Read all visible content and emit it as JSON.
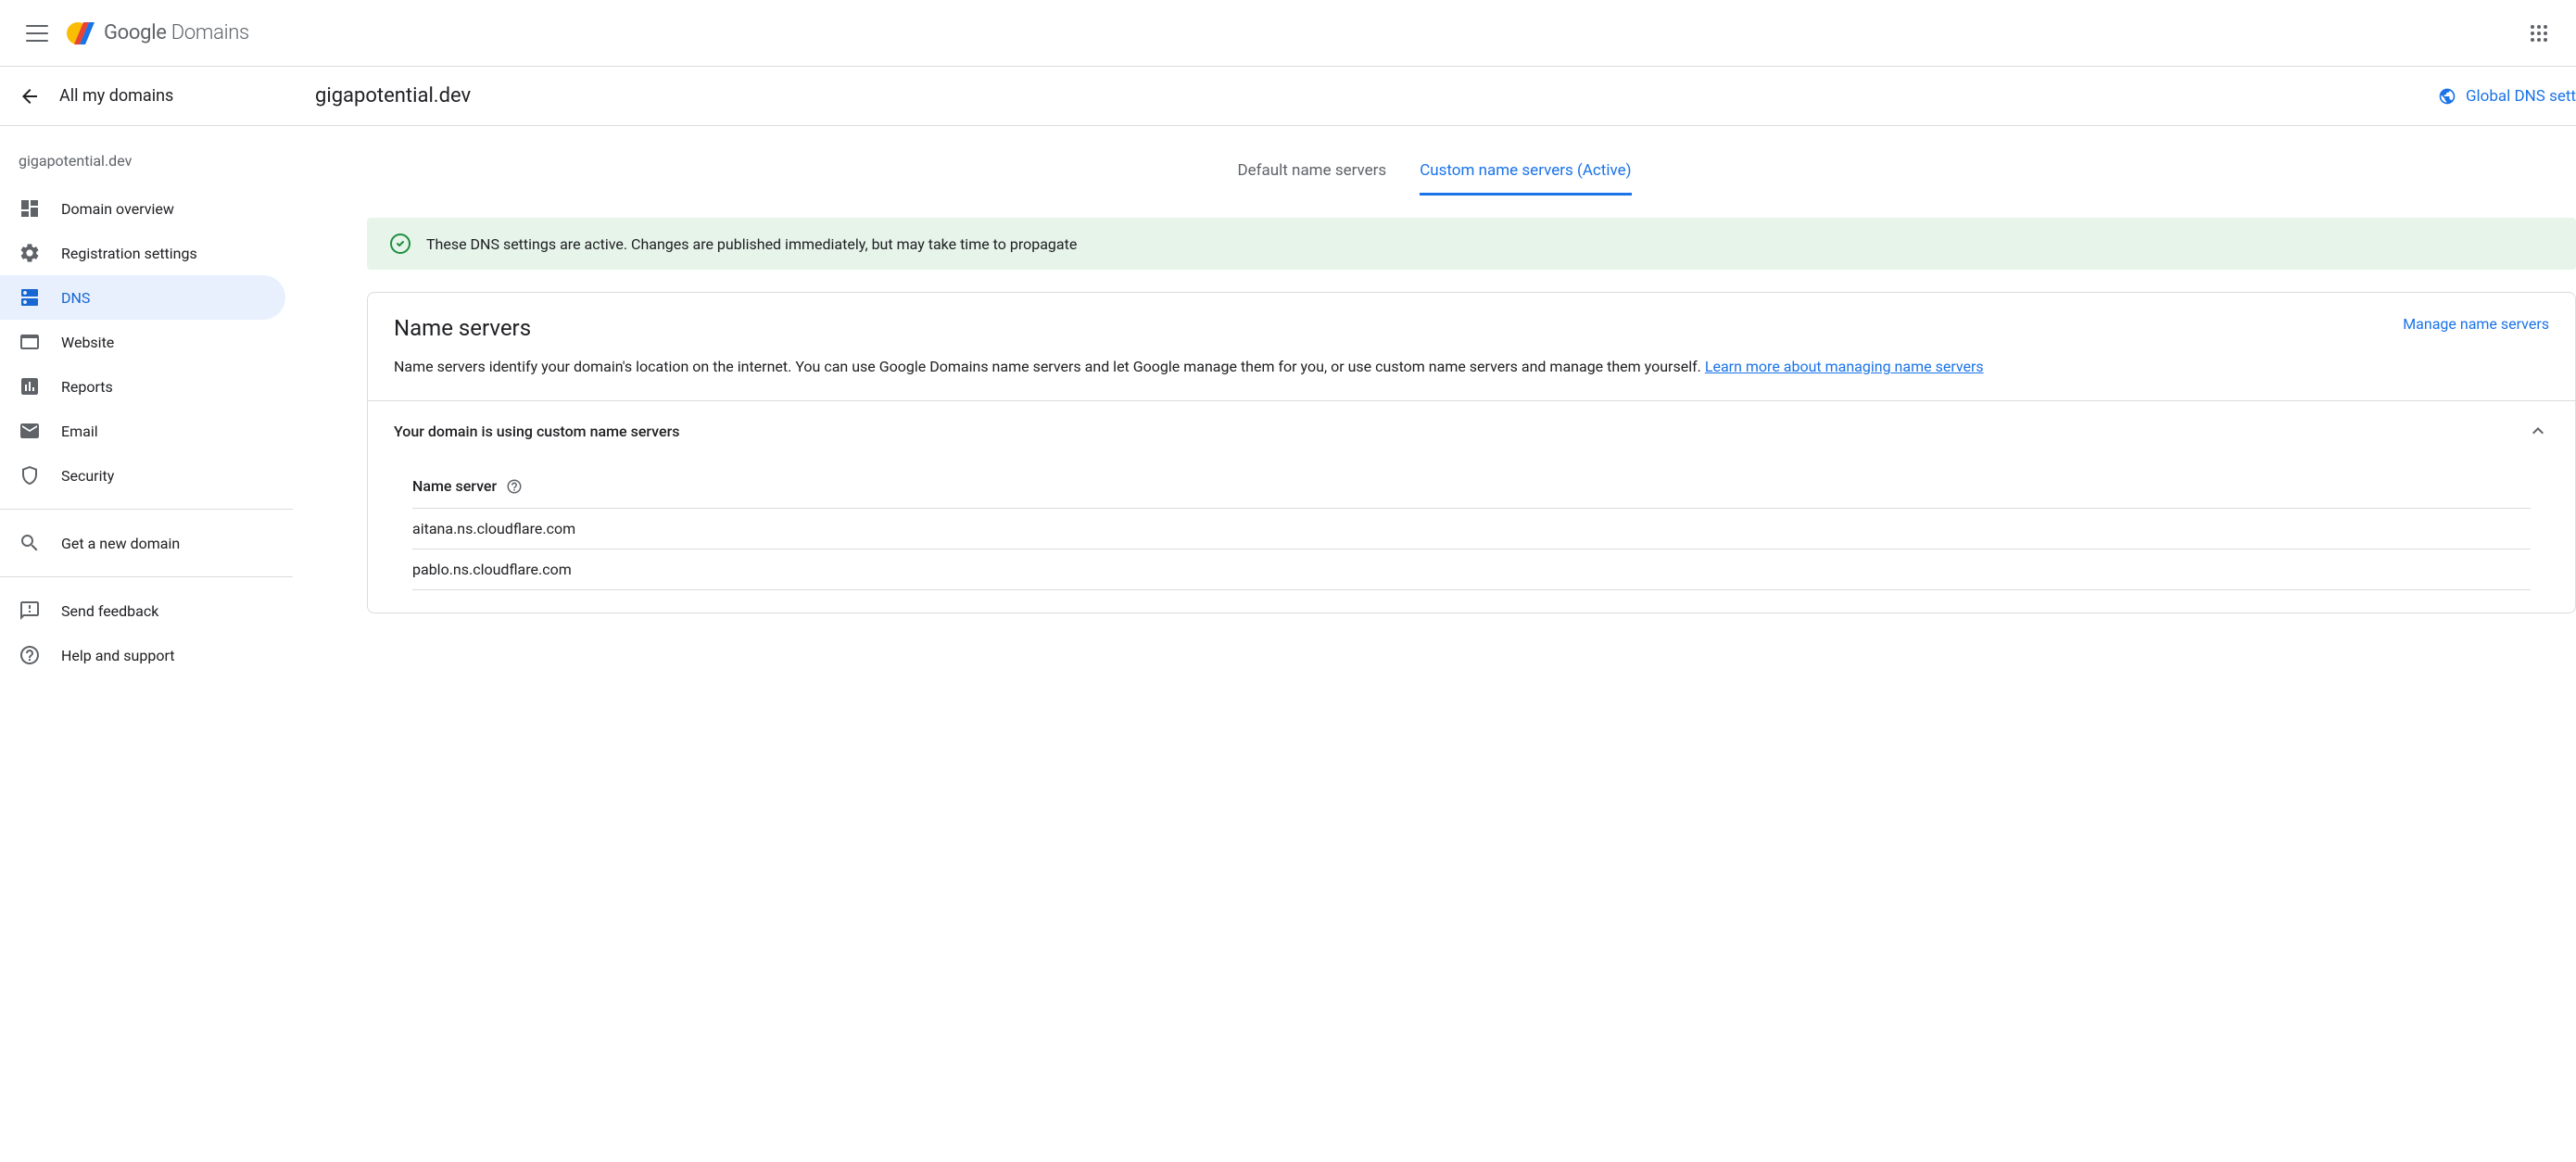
{
  "header": {
    "logo_google": "Google",
    "logo_domains": " Domains"
  },
  "subheader": {
    "back_label": "All my domains",
    "domain_name": "gigapotential.dev",
    "global_dns": "Global DNS sett"
  },
  "sidebar": {
    "domain": "gigapotential.dev",
    "items": [
      {
        "label": "Domain overview"
      },
      {
        "label": "Registration settings"
      },
      {
        "label": "DNS"
      },
      {
        "label": "Website"
      },
      {
        "label": "Reports"
      },
      {
        "label": "Email"
      },
      {
        "label": "Security"
      }
    ],
    "get_domain": "Get a new domain",
    "feedback": "Send feedback",
    "help": "Help and support"
  },
  "tabs": {
    "default": "Default name servers",
    "custom": "Custom name servers (Active)"
  },
  "alert": {
    "text": "These DNS settings are active. Changes are published immediately, but may take time to propagate"
  },
  "card": {
    "title": "Name servers",
    "manage": "Manage name servers",
    "desc_part1": "Name servers identify your domain's location on the internet. You can use Google Domains name servers and let Google manage them for you, or use custom name servers and manage them yourself. ",
    "desc_link": "Learn more about managing name servers",
    "section_title": "Your domain is using custom name servers",
    "ns_header": "Name server",
    "servers": [
      "aitana.ns.cloudflare.com",
      "pablo.ns.cloudflare.com"
    ]
  }
}
